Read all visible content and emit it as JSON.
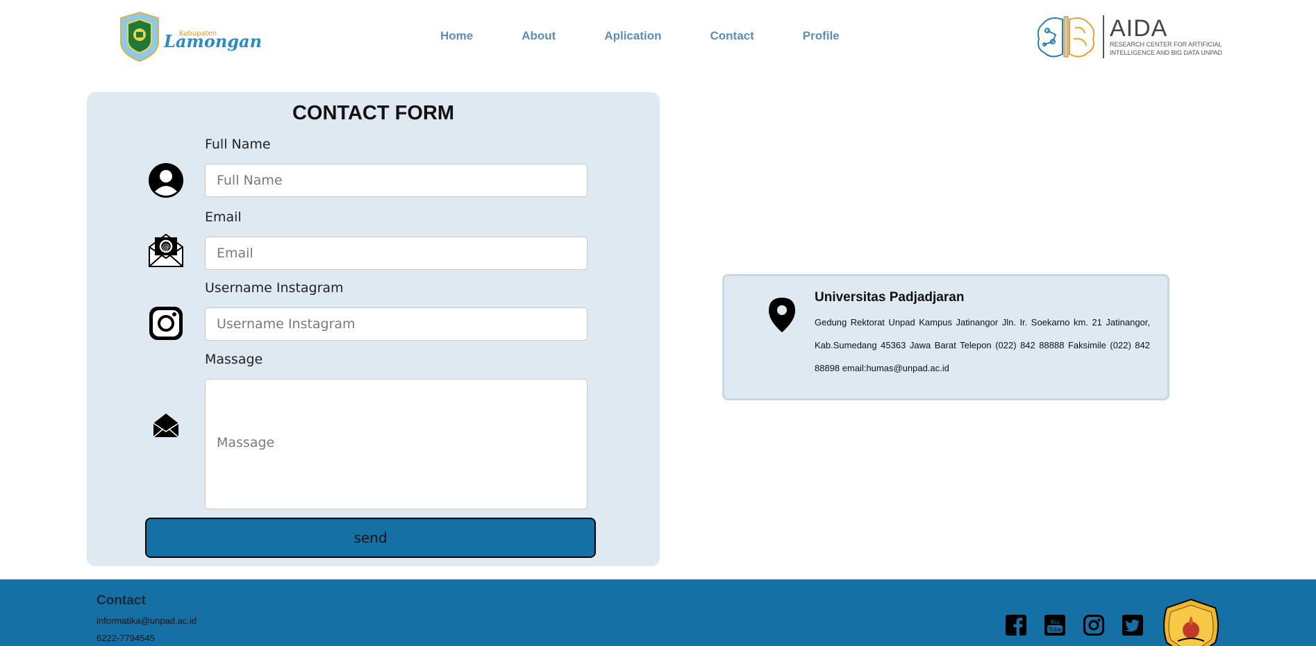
{
  "header": {
    "lamongan_logo": {
      "small_text": "Kabupaten",
      "big_text": "Lamongan"
    },
    "nav": [
      {
        "label": "Home"
      },
      {
        "label": "About"
      },
      {
        "label": "Aplication"
      },
      {
        "label": "Contact"
      },
      {
        "label": "Profile"
      }
    ],
    "aida_logo": {
      "title": "AIDA",
      "sub_line1": "RESEARCH CENTER FOR ARTIFICIAL",
      "sub_line2": "INTELLIGENCE AND BIG DATA UNPAD"
    }
  },
  "contact_form": {
    "title": "CONTACT FORM",
    "fields": [
      {
        "label": "Full Name",
        "placeholder": "Full Name",
        "value": "",
        "icon": "user-icon"
      },
      {
        "label": "Email",
        "placeholder": "Email",
        "value": "",
        "icon": "envelope-at-icon"
      },
      {
        "label": "Username Instagram",
        "placeholder": "Username Instagram",
        "value": "",
        "icon": "instagram-icon"
      },
      {
        "label": "Massage",
        "placeholder": "Massage",
        "value": "",
        "icon": "envelope-open-icon"
      }
    ],
    "send_label": "send",
    "send_color": "#1570a6"
  },
  "address": {
    "icon": "map-pin-icon",
    "org": "Universitas Padjadjaran",
    "text": "Gedung Rektorat Unpad Kampus Jatinangor Jln. Ir. Soekarno km. 21 Jatinangor, Kab.Sumedang 45363 Jawa Barat Telepon (022) 842 88888 Faksimile (022) 842 88898 email:humas@unpad.ac.id"
  },
  "footer": {
    "title": "Contact",
    "email": "informatika@unpad.ac.id",
    "phone": "6222-7794545",
    "social": [
      "facebook-icon",
      "youtube-icon",
      "instagram-icon",
      "twitter-icon"
    ],
    "bg_color": "#1570a6"
  }
}
